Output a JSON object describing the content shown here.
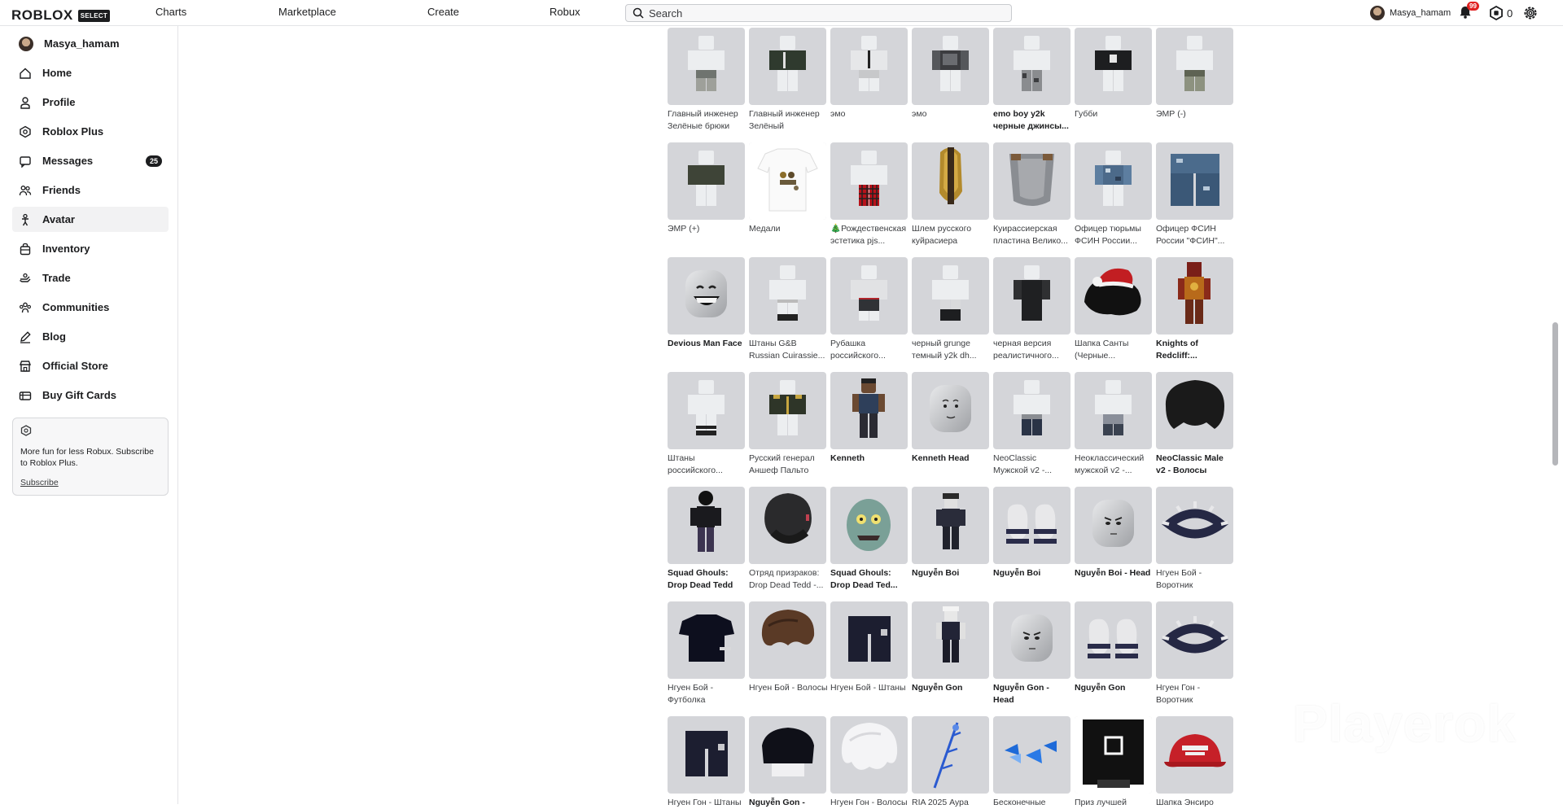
{
  "topbar": {
    "logo_text": "ROBLOX",
    "select_badge": "SELECT",
    "nav": [
      "Charts",
      "Marketplace",
      "Create",
      "Robux"
    ],
    "search_placeholder": "Search",
    "username": "Masya_hamam",
    "notifications_count": "99",
    "robux_balance": "0"
  },
  "sidebar": {
    "user": "Masya_hamam",
    "items": [
      {
        "label": "Home",
        "icon": "home-icon"
      },
      {
        "label": "Profile",
        "icon": "profile-icon"
      },
      {
        "label": "Roblox Plus",
        "icon": "roblox-plus-icon"
      },
      {
        "label": "Messages",
        "icon": "messages-icon",
        "badge": "25"
      },
      {
        "label": "Friends",
        "icon": "friends-icon"
      },
      {
        "label": "Avatar",
        "icon": "avatar-icon",
        "active": true
      },
      {
        "label": "Inventory",
        "icon": "inventory-icon"
      },
      {
        "label": "Trade",
        "icon": "trade-icon"
      },
      {
        "label": "Communities",
        "icon": "communities-icon"
      },
      {
        "label": "Blog",
        "icon": "blog-icon"
      },
      {
        "label": "Official Store",
        "icon": "store-icon"
      },
      {
        "label": "Buy Gift Cards",
        "icon": "gift-card-icon"
      }
    ],
    "promo": {
      "text": "More fun for less Robux. Subscribe to Roblox Plus.",
      "link": "Subscribe"
    }
  },
  "items": [
    [
      {
        "name": "Главный инженер Зелёные брюки",
        "kind": "pants-gray"
      },
      {
        "name": "Главный инженер Зелёный",
        "kind": "shirt-green"
      },
      {
        "name": "эмо",
        "kind": "shirt-tie"
      },
      {
        "name": "эмо",
        "kind": "shirt-dark"
      },
      {
        "name": "emo boy y2k черные джинсы...",
        "kind": "pants-camo"
      },
      {
        "name": "Губби",
        "kind": "shirt-black"
      },
      {
        "name": "ЭМР (-)",
        "kind": "pants-olive"
      }
    ],
    [
      {
        "name": "ЭМР (+)",
        "kind": "shirt-olive"
      },
      {
        "name": "Медали",
        "kind": "tshirt-medals"
      },
      {
        "name": "🎄Рождественская эстетика pjs...",
        "kind": "pants-plaid"
      },
      {
        "name": "Шлем русского куйрасиера",
        "kind": "helmet"
      },
      {
        "name": "Куирассиерская пластина Велико...",
        "kind": "cuirass"
      },
      {
        "name": "Офицер тюрьмы ФСИН России...",
        "kind": "shirt-camo-blue"
      },
      {
        "name": "Офицер ФСИН России \"ФСИН\"...",
        "kind": "pants-camo-blue"
      }
    ],
    [
      {
        "name": "Devious Man Face",
        "kind": "face-grin"
      },
      {
        "name": "Штаны G&B Russian Cuirassie...",
        "kind": "pants-white"
      },
      {
        "name": "Рубашка российского...",
        "kind": "shirt-white-red"
      },
      {
        "name": "черный grunge темный y2k dh...",
        "kind": "pants-white-black"
      },
      {
        "name": "черная версия реалистичного...",
        "kind": "shirt-black-full"
      },
      {
        "name": "Шапка Санты (Черные...",
        "kind": "santa-hair"
      },
      {
        "name": "Knights of Redcliff:...",
        "kind": "knight"
      }
    ],
    [
      {
        "name": "Штаны российского...",
        "kind": "pants-white-stripe"
      },
      {
        "name": "Русский генерал Аншеф Пальто",
        "kind": "shirt-general"
      },
      {
        "name": "Kenneth",
        "kind": "kenneth"
      },
      {
        "name": "Kenneth Head",
        "kind": "head-gray"
      },
      {
        "name": "NeoClassic Мужской v2 -...",
        "kind": "pants-navy"
      },
      {
        "name": "Неоклассический мужской v2 -...",
        "kind": "pants-navy-gray"
      },
      {
        "name": "NeoClassic Male v2 - Волосы",
        "kind": "hair-black"
      }
    ],
    [
      {
        "name": "Squad Ghouls: Drop Dead Tedd",
        "kind": "ghoul-body"
      },
      {
        "name": "Отряд призраков: Drop Dead Tedd -...",
        "kind": "ghoul-hair"
      },
      {
        "name": "Squad Ghouls: Drop Dead Ted...",
        "kind": "ghoul-head"
      },
      {
        "name": "Nguyễn Boi",
        "kind": "boi-body"
      },
      {
        "name": "Nguyễn Boi",
        "kind": "boots"
      },
      {
        "name": "Nguyễn Boi - Head",
        "kind": "head-gray-face"
      },
      {
        "name": "Нгуен Бой - Воротник",
        "kind": "collar"
      }
    ],
    [
      {
        "name": "Нгуен Бой - Футболка",
        "kind": "tshirt-black"
      },
      {
        "name": "Нгуен Бой - Волосы",
        "kind": "hair-brown"
      },
      {
        "name": "Нгуен Бой - Штаны",
        "kind": "shorts-black"
      },
      {
        "name": "Nguyễn Gon",
        "kind": "gon-body"
      },
      {
        "name": "Nguyễn Gon - Head",
        "kind": "head-gray-face"
      },
      {
        "name": "Nguyễn Gon",
        "kind": "boots"
      },
      {
        "name": "Нгуен Гон - Воротник",
        "kind": "collar"
      }
    ],
    [
      {
        "name": "Нгуен Гон - Штаны",
        "kind": "shorts-black"
      },
      {
        "name": "Nguyễn Gon -",
        "kind": "top-black"
      },
      {
        "name": "Нгуен Гон - Волосы",
        "kind": "hair-white"
      },
      {
        "name": "RIA 2025 Аура",
        "kind": "aura"
      },
      {
        "name": "Бесконечные",
        "kind": "blue-shards"
      },
      {
        "name": "Приз лучшей",
        "kind": "award"
      },
      {
        "name": "Шапка Энсиро",
        "kind": "red-cap"
      }
    ]
  ],
  "bold_names": [
    "emo boy y2k",
    "Devious Man Face",
    "Kenneth",
    "Kenneth Head",
    "Squad Ghouls: Drop Dead Tedd",
    "Nguyễn Boi",
    "Nguyễn Gon",
    "NeoClassic Male v2 - Волосы",
    "Knights of Redcliff:..."
  ],
  "watermark": "Playerok"
}
